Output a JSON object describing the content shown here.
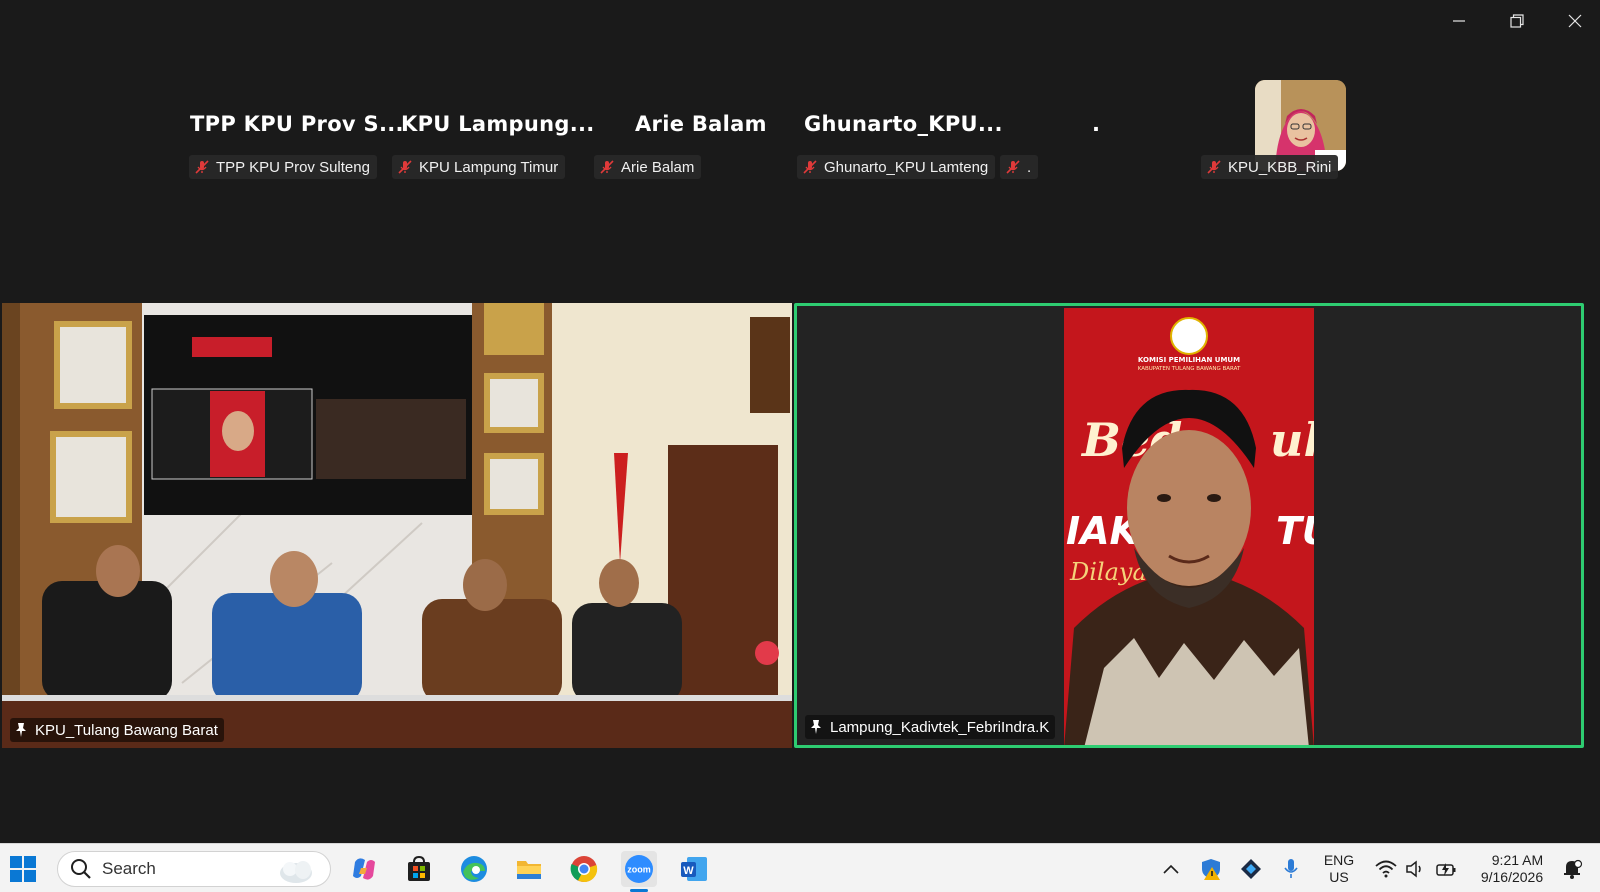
{
  "colors": {
    "background": "#1a1a1a",
    "active_speaker_border": "#2ecc71",
    "muted_red": "#e03a3a",
    "taskbar": "#f3f3f3"
  },
  "window": {
    "icons": [
      "minimize-icon",
      "restore-icon",
      "close-icon"
    ]
  },
  "participants": [
    {
      "display_name": "TPP KPU Prov S...",
      "tag": "TPP KPU Prov Sulteng"
    },
    {
      "display_name": "KPU Lampung...",
      "tag": "KPU Lampung Timur"
    },
    {
      "display_name": "Arie Balam",
      "tag": "Arie Balam"
    },
    {
      "display_name": "Ghunarto_KPU...",
      "tag": "Ghunarto_KPU Lamteng"
    },
    {
      "display_name": ".",
      "tag": "."
    },
    {
      "display_name": "",
      "tag": "KPU_KBB_Rini"
    }
  ],
  "videos": {
    "left": {
      "name": "KPU_Tulang Bawang Barat"
    },
    "right": {
      "name": "Lampung_Kadivtek_FebriIndra.K"
    }
  },
  "banner": {
    "org": "KOMISI PEMILIHAN UMUM",
    "region": "KABUPATEN TULANG BAWANG BARAT",
    "script1": "Bed",
    "script2": "uk",
    "line2a": "IAK K",
    "line2b": "TUS",
    "line3": "Dilaya"
  },
  "taskbar": {
    "search_placeholder": "Search",
    "apps": [
      "windows-start-icon",
      "copilot-icon",
      "microsoft-store-icon",
      "edge-icon",
      "file-explorer-icon",
      "chrome-icon",
      "zoom-icon",
      "word-icon"
    ],
    "zoom_label": "zoom",
    "word_label": "W",
    "lang_line1": "ENG",
    "lang_line2": "US",
    "time": "9:21 AM",
    "date": "9/16/2026"
  }
}
